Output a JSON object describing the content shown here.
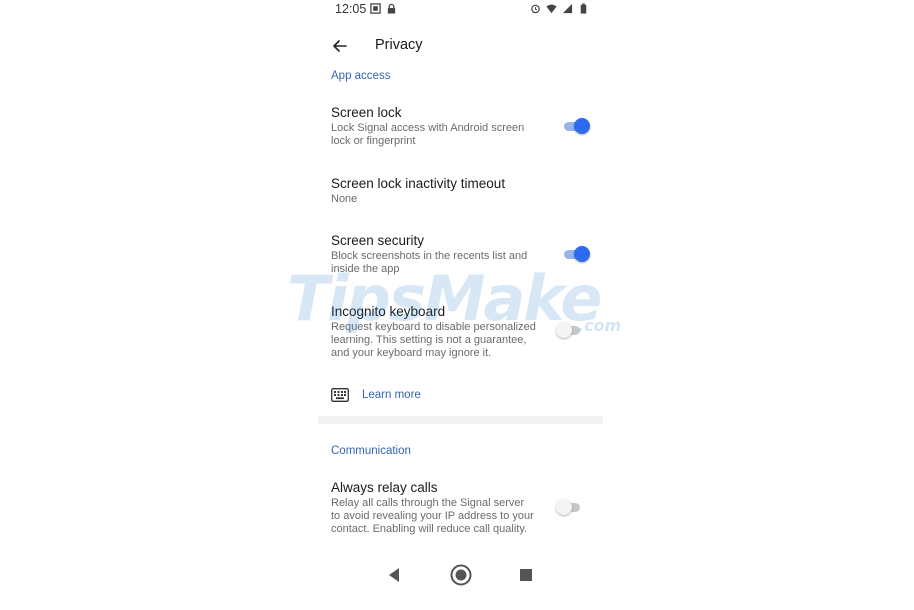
{
  "status_bar": {
    "time": "12:05",
    "left_icons": [
      "screenshot-icon",
      "lock-icon"
    ],
    "right_icons": [
      "alarm-icon",
      "wifi-icon",
      "signal-icon",
      "battery-icon"
    ]
  },
  "toolbar": {
    "back_icon": "back-arrow-icon",
    "title": "Privacy"
  },
  "sections": {
    "app_access": "App access",
    "communication": "Communication"
  },
  "prefs": {
    "screen_lock": {
      "title": "Screen lock",
      "summary": "Lock Signal access with Android screen lock or fingerprint",
      "enabled": true
    },
    "inactivity_timeout": {
      "title": "Screen lock inactivity timeout",
      "summary": "None"
    },
    "screen_security": {
      "title": "Screen security",
      "summary": "Block screenshots in the recents list and inside the app",
      "enabled": true
    },
    "incognito_keyboard": {
      "title": "Incognito keyboard",
      "summary": "Request keyboard to disable personalized learning. This setting is not a guarantee, and your keyboard may ignore it.",
      "enabled": false
    },
    "learn_more": {
      "icon": "keyboard-icon",
      "label": "Learn more"
    },
    "always_relay_calls": {
      "title": "Always relay calls",
      "summary": "Relay all calls through the Signal server to avoid revealing your IP address to your contact. Enabling will reduce call quality.",
      "enabled": false
    }
  },
  "nav_bar": [
    "back-triangle-icon",
    "home-circle-icon",
    "recents-square-icon"
  ],
  "watermark": {
    "text": "TipsMake",
    "suffix": ".com"
  },
  "colors": {
    "accent": "#3565b0",
    "switch_on": "#2c6bed",
    "switch_on_track": "#9ab4ea",
    "switch_off_track": "#c8c8c8"
  }
}
